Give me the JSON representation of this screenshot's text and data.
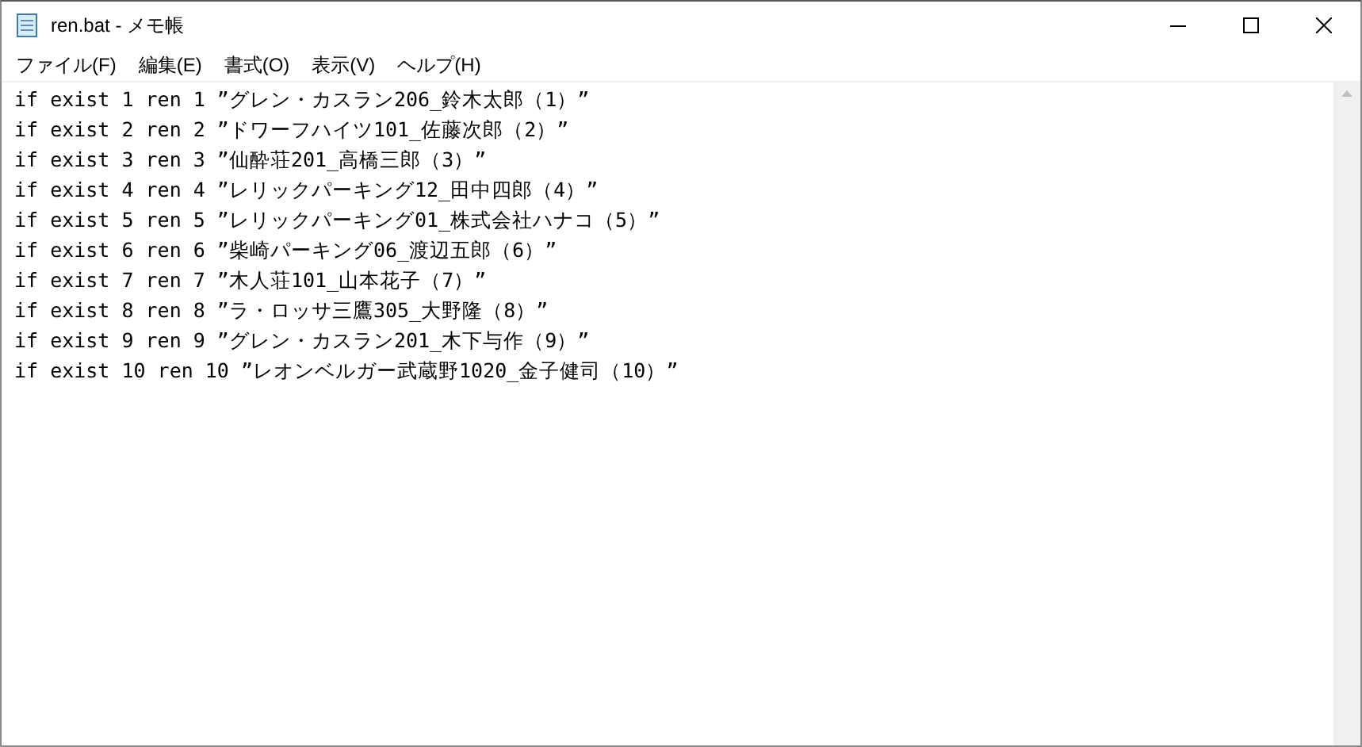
{
  "window": {
    "title": "ren.bat - メモ帳"
  },
  "menu": [
    {
      "label": "ファイル(F)"
    },
    {
      "label": "編集(E)"
    },
    {
      "label": "書式(O)"
    },
    {
      "label": "表示(V)"
    },
    {
      "label": "ヘルプ(H)"
    }
  ],
  "editor": {
    "lines": [
      "if exist 1 ren 1 ”グレン・カスラン206_鈴木太郎（1）”",
      "if exist 2 ren 2 ”ドワーフハイツ101_佐藤次郎（2）”",
      "if exist 3 ren 3 ”仙酔荘201_高橋三郎（3）”",
      "if exist 4 ren 4 ”レリックパーキング12_田中四郎（4）”",
      "if exist 5 ren 5 ”レリックパーキング01_株式会社ハナコ（5）”",
      "if exist 6 ren 6 ”柴崎パーキング06_渡辺五郎（6）”",
      "if exist 7 ren 7 ”木人荘101_山本花子（7）”",
      "if exist 8 ren 8 ”ラ・ロッサ三鷹305_大野隆（8）”",
      "if exist 9 ren 9 ”グレン・カスラン201_木下与作（9）”",
      "if exist 10 ren 10 ”レオンベルガー武蔵野1020_金子健司（10）”"
    ]
  }
}
